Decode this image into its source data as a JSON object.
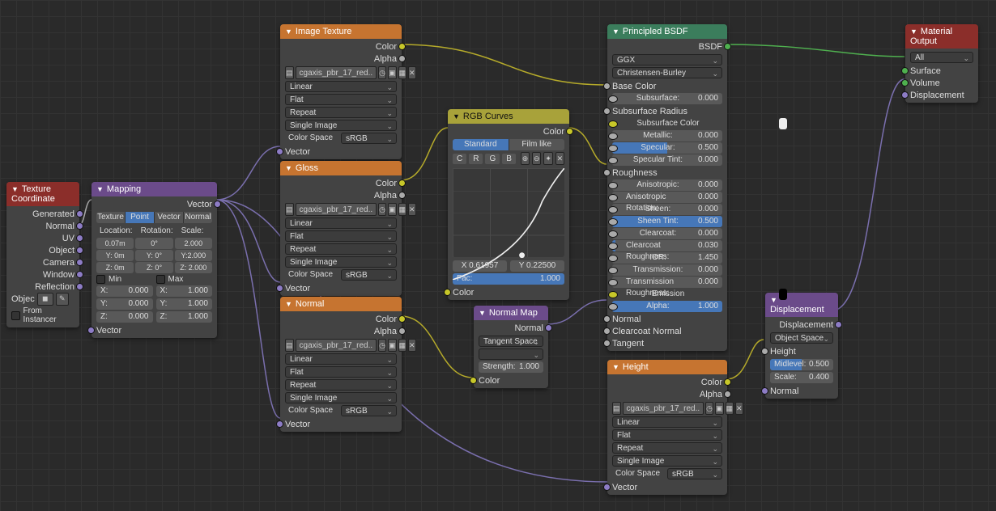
{
  "nodes": {
    "texcoord": {
      "title": "Texture Coordinate",
      "outputs": [
        "Generated",
        "Normal",
        "UV",
        "Object",
        "Camera",
        "Window",
        "Reflection"
      ],
      "object_label": "Objec",
      "from_instancer": "From Instancer"
    },
    "mapping": {
      "title": "Mapping",
      "out_vector": "Vector",
      "tabs": [
        "Texture",
        "Point",
        "Vector",
        "Normal"
      ],
      "col_headers": [
        "Location:",
        "Rotation:",
        "Scale:"
      ],
      "rows": [
        [
          "0.07m",
          "0°",
          "2.000"
        ],
        [
          "Y: 0m",
          "Y: 0°",
          "Y:2.000"
        ],
        [
          "Z: 0m",
          "Z: 0°",
          "Z: 2.000"
        ]
      ],
      "min_label": "Min",
      "max_label": "Max",
      "minmax": [
        [
          "X:",
          "0.000",
          "X:",
          "1.000"
        ],
        [
          "Y:",
          "0.000",
          "Y:",
          "1.000"
        ],
        [
          "Z:",
          "0.000",
          "Z:",
          "1.000"
        ]
      ],
      "in_vector": "Vector"
    },
    "imgtex": {
      "title": "Image Texture",
      "out_color": "Color",
      "out_alpha": "Alpha",
      "filename": "cgaxis_pbr_17_red..",
      "interp": "Linear",
      "proj": "Flat",
      "ext": "Repeat",
      "single": "Single Image",
      "colorspace_l": "Color Space",
      "colorspace_v": "sRGB",
      "in_vector": "Vector"
    },
    "gloss": {
      "title": "Gloss"
    },
    "normal": {
      "title": "Normal"
    },
    "height": {
      "title": "Height"
    },
    "rgbcurves": {
      "title": "RGB Curves",
      "out_color": "Color",
      "tabs": [
        "Standard",
        "Film like"
      ],
      "chan": [
        "C",
        "R",
        "G",
        "B"
      ],
      "x": "X 0.61957",
      "y": "Y 0.22500",
      "fac_l": "Fac:",
      "fac_v": "1.000",
      "in_color": "Color"
    },
    "normalmap": {
      "title": "Normal Map",
      "out_normal": "Normal",
      "space": "Tangent Space",
      "strength_l": "Strength:",
      "strength_v": "1.000",
      "in_color": "Color"
    },
    "principled": {
      "title": "Principled BSDF",
      "out_bsdf": "BSDF",
      "distribution": "GGX",
      "sss": "Christensen-Burley",
      "rows": [
        {
          "l": "Base Color",
          "type": "label-in"
        },
        {
          "l": "Subsurface:",
          "v": "0.000",
          "type": "val"
        },
        {
          "l": "Subsurface Radius",
          "type": "label-in"
        },
        {
          "l": "Subsurface Color",
          "type": "swatch",
          "color": "#eeeeee"
        },
        {
          "l": "Metallic:",
          "v": "0.000",
          "type": "val"
        },
        {
          "l": "Specular:",
          "v": "0.500",
          "type": "half"
        },
        {
          "l": "Specular Tint:",
          "v": "0.000",
          "type": "val"
        },
        {
          "l": "Roughness",
          "type": "label-in"
        },
        {
          "l": "Anisotropic:",
          "v": "0.000",
          "type": "val"
        },
        {
          "l": "Anisotropic Rotation:",
          "v": "0.000",
          "type": "val"
        },
        {
          "l": "Sheen:",
          "v": "0.000",
          "type": "val"
        },
        {
          "l": "Sheen Tint:",
          "v": "0.500",
          "type": "half-blue"
        },
        {
          "l": "Clearcoat:",
          "v": "0.000",
          "type": "val"
        },
        {
          "l": "Clearcoat Roughness:",
          "v": "0.030",
          "type": "small"
        },
        {
          "l": "IOR:",
          "v": "1.450",
          "type": "val"
        },
        {
          "l": "Transmission:",
          "v": "0.000",
          "type": "val"
        },
        {
          "l": "Transmission Roughness:",
          "v": "0.000",
          "type": "val"
        },
        {
          "l": "Emission",
          "type": "swatch",
          "color": "#000"
        },
        {
          "l": "Alpha:",
          "v": "1.000",
          "type": "full-blue"
        },
        {
          "l": "Normal",
          "type": "label-in"
        },
        {
          "l": "Clearcoat Normal",
          "type": "label-in"
        },
        {
          "l": "Tangent",
          "type": "label-in"
        }
      ]
    },
    "displacement": {
      "title": "Displacement",
      "out": "Displacement",
      "space": "Object Space",
      "height_l": "Height",
      "midlevel_l": "Midlevel:",
      "midlevel_v": "0.500",
      "scale_l": "Scale:",
      "scale_v": "0.400",
      "normal_l": "Normal"
    },
    "output": {
      "title": "Material Output",
      "target": "All",
      "inputs": [
        "Surface",
        "Volume",
        "Displacement"
      ]
    }
  }
}
